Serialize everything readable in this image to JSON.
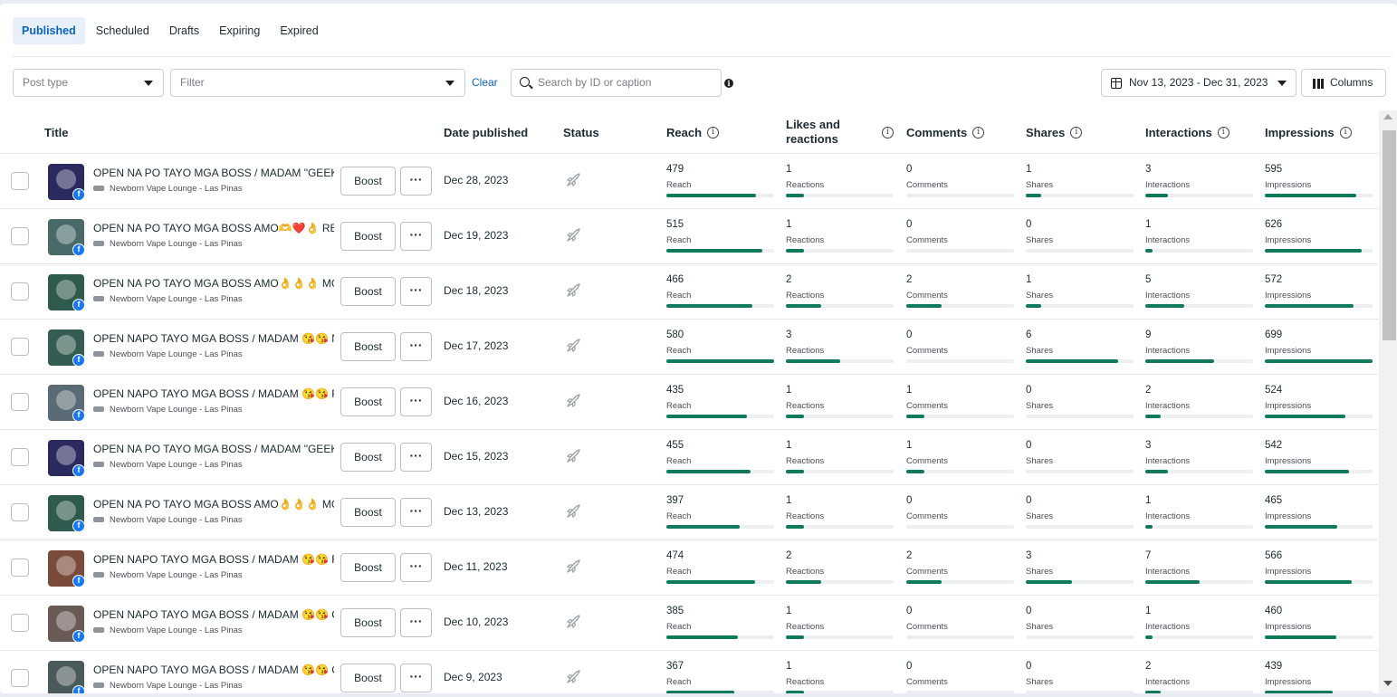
{
  "tabs": [
    {
      "label": "Published",
      "active": true
    },
    {
      "label": "Scheduled",
      "active": false
    },
    {
      "label": "Drafts",
      "active": false
    },
    {
      "label": "Expiring",
      "active": false
    },
    {
      "label": "Expired",
      "active": false
    }
  ],
  "toolbar": {
    "post_type_placeholder": "Post type",
    "filter_placeholder": "Filter",
    "clear_label": "Clear",
    "search_placeholder": "Search by ID or caption",
    "date_range": "Nov 13, 2023 - Dec 31, 2023",
    "columns_label": "Columns"
  },
  "columns": {
    "title": "Title",
    "date_published": "Date published",
    "status": "Status",
    "reach": "Reach",
    "likes": "Likes and reactions",
    "comments": "Comments",
    "shares": "Shares",
    "interactions": "Interactions",
    "impressions": "Impressions"
  },
  "labels": {
    "boost": "Boost",
    "more": "···",
    "reach": "Reach",
    "reactions": "Reactions",
    "comments": "Comments",
    "shares": "Shares",
    "interactions": "Interactions",
    "impressions": "Impressions"
  },
  "posts": [
    {
      "title": "OPEN NA PO TAYO MGA BOSS / MADAM \"GEEKV...",
      "page": "Newborn Vape Lounge - Las Pinas",
      "date": "Dec 28, 2023",
      "reach": 479,
      "reactions": 1,
      "comments": 0,
      "shares": 1,
      "interactions": 3,
      "impressions": 595,
      "thumb": "#2b2a5e"
    },
    {
      "title": "OPEN NA PO TAYO MGA BOSS AMO🫶❤️👌 RE...",
      "page": "Newborn Vape Lounge - Las Pinas",
      "date": "Dec 19, 2023",
      "reach": 515,
      "reactions": 1,
      "comments": 0,
      "shares": 0,
      "interactions": 1,
      "impressions": 626,
      "thumb": "#4a6a6a"
    },
    {
      "title": "OPEN NA PO TAYO MGA BOSS AMO👌👌👌 MG...",
      "page": "Newborn Vape Lounge - Las Pinas",
      "date": "Dec 18, 2023",
      "reach": 466,
      "reactions": 2,
      "comments": 2,
      "shares": 1,
      "interactions": 5,
      "impressions": 572,
      "thumb": "#2f5a4e"
    },
    {
      "title": "OPEN NAPO TAYO MGA BOSS / MADAM 😘😘 N...",
      "page": "Newborn Vape Lounge - Las Pinas",
      "date": "Dec 17, 2023",
      "reach": 580,
      "reactions": 3,
      "comments": 0,
      "shares": 6,
      "interactions": 9,
      "impressions": 699,
      "thumb": "#355c52"
    },
    {
      "title": "OPEN NAPO TAYO MGA BOSS / MADAM 😘😘 F...",
      "page": "Newborn Vape Lounge - Las Pinas",
      "date": "Dec 16, 2023",
      "reach": 435,
      "reactions": 1,
      "comments": 1,
      "shares": 0,
      "interactions": 2,
      "impressions": 524,
      "thumb": "#5a6b75"
    },
    {
      "title": "OPEN NA PO TAYO MGA BOSS / MADAM \"GEEKV...",
      "page": "Newborn Vape Lounge - Las Pinas",
      "date": "Dec 15, 2023",
      "reach": 455,
      "reactions": 1,
      "comments": 1,
      "shares": 0,
      "interactions": 3,
      "impressions": 542,
      "thumb": "#2b2a5e"
    },
    {
      "title": "OPEN NA PO TAYO MGA BOSS AMO👌👌👌 MG...",
      "page": "Newborn Vape Lounge - Las Pinas",
      "date": "Dec 13, 2023",
      "reach": 397,
      "reactions": 1,
      "comments": 0,
      "shares": 0,
      "interactions": 1,
      "impressions": 465,
      "thumb": "#2f5a4e"
    },
    {
      "title": "OPEN NAPO TAYO MGA BOSS / MADAM 😘😘 R...",
      "page": "Newborn Vape Lounge - Las Pinas",
      "date": "Dec 11, 2023",
      "reach": 474,
      "reactions": 2,
      "comments": 2,
      "shares": 3,
      "interactions": 7,
      "impressions": 566,
      "thumb": "#7a4a3a"
    },
    {
      "title": "OPEN NAPO TAYO MGA BOSS / MADAM 😘😘 C...",
      "page": "Newborn Vape Lounge - Las Pinas",
      "date": "Dec 10, 2023",
      "reach": 385,
      "reactions": 1,
      "comments": 0,
      "shares": 0,
      "interactions": 1,
      "impressions": 460,
      "thumb": "#6a5a55"
    },
    {
      "title": "OPEN NAPO TAYO MGA BOSS / MADAM 😘😘 C...",
      "page": "Newborn Vape Lounge - Las Pinas",
      "date": "Dec 9, 2023",
      "reach": 367,
      "reactions": 1,
      "comments": 0,
      "shares": 0,
      "interactions": 2,
      "impressions": 439,
      "thumb": "#4a5a5a"
    }
  ],
  "colors": {
    "accent": "#0a64c2",
    "bar": "#0f7a5c",
    "facebook": "#1877f2"
  }
}
